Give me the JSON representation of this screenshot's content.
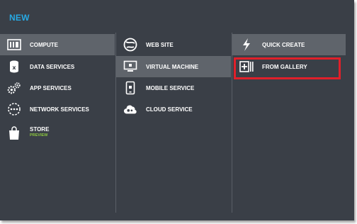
{
  "dialog": {
    "title": "NEW"
  },
  "column1": {
    "items": [
      {
        "label": "COMPUTE",
        "icon": "compute-icon"
      },
      {
        "label": "DATA SERVICES",
        "icon": "data-services-icon"
      },
      {
        "label": "APP SERVICES",
        "icon": "app-services-icon"
      },
      {
        "label": "NETWORK SERVICES",
        "icon": "network-services-icon"
      },
      {
        "label": "STORE",
        "sublabel": "PREVIEW",
        "icon": "store-icon"
      }
    ]
  },
  "column2": {
    "items": [
      {
        "label": "WEB SITE",
        "icon": "web-site-icon"
      },
      {
        "label": "VIRTUAL MACHINE",
        "icon": "virtual-machine-icon"
      },
      {
        "label": "MOBILE SERVICE",
        "icon": "mobile-service-icon"
      },
      {
        "label": "CLOUD SERVICE",
        "icon": "cloud-service-icon"
      }
    ]
  },
  "column3": {
    "items": [
      {
        "label": "QUICK CREATE",
        "icon": "lightning-icon"
      },
      {
        "label": "FROM GALLERY",
        "icon": "gallery-icon"
      }
    ]
  },
  "colors": {
    "background": "#3a3f47",
    "selected": "#5f646b",
    "accent_title": "#27a9e3",
    "preview_green": "#8cc63f",
    "highlight_red": "#e0202a"
  }
}
